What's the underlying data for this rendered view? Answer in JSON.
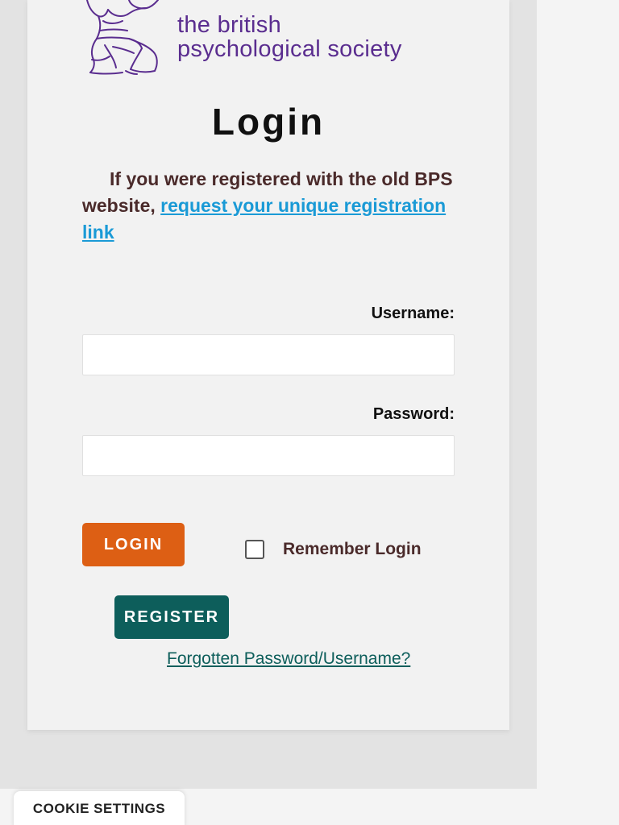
{
  "logo": {
    "line1": "the british",
    "line2": "psychological society",
    "icon": "bps-figure-logo",
    "color": "#5a2d8f"
  },
  "title": "Login",
  "intro": {
    "text": "If you were registered with the old BPS website, ",
    "link_text": "request your unique registration link",
    "link_color": "#1a9ad6"
  },
  "form": {
    "username_label": "Username:",
    "username_value": "",
    "password_label": "Password:",
    "password_value": "",
    "login_button": "LOGIN",
    "remember_label": "Remember Login",
    "remember_checked": false,
    "register_button": "REGISTER",
    "forgot_link": "Forgotten Password/Username?"
  },
  "colors": {
    "login_button": "#dd5f14",
    "register_button": "#0d5e5b",
    "forgot_link": "#0d5e5b"
  },
  "cookie_settings": "COOKIE SETTINGS"
}
